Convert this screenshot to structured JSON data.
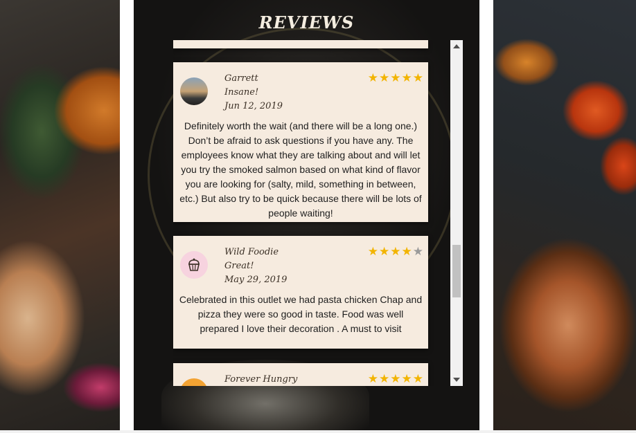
{
  "section": {
    "title": "REVIEWS"
  },
  "reviews": [
    {
      "name": "Garrett",
      "headline": "Insane!",
      "date": "Jun 12, 2019",
      "rating": 5,
      "text": "Definitely worth the wait (and there will be a long one.) Don’t be afraid to ask questions if you have any. The employees know what they are talking about and will let you try the smoked salmon based on what kind of flavor you are looking for (salty, mild, something in between, etc.) But also try to be quick because there will be lots of people waiting!",
      "avatar": "photo-avatar"
    },
    {
      "name": "Wild Foodie",
      "headline": "Great!",
      "date": "May 29, 2019",
      "rating": 4,
      "text": "Celebrated in this outlet we had pasta chicken Chap and pizza they were so good in taste. Food was well prepared I love their decoration . A must to visit",
      "avatar": "cupcake-icon"
    },
    {
      "name": "Forever Hungry",
      "rating": 5,
      "avatar": "orange-avatar"
    }
  ],
  "stars": {
    "filled": "★",
    "empty": "★"
  },
  "colors": {
    "star_on": "#f2b400",
    "star_off": "#9a9a9a",
    "card_bg": "#f6ebdf"
  }
}
